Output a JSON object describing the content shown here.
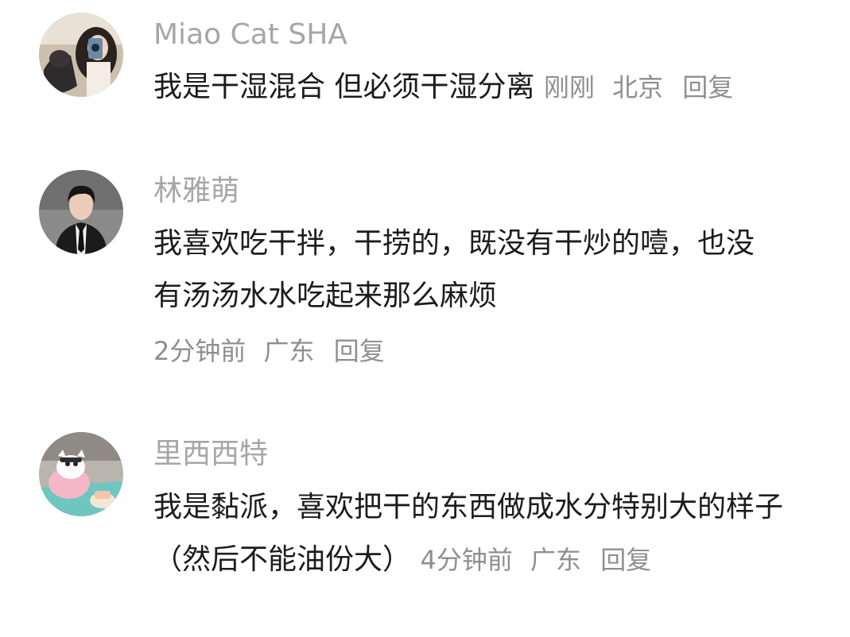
{
  "comments": [
    {
      "username": "Miao Cat SHA",
      "text": "我是干湿混合 但必须干湿分离",
      "time": "刚刚",
      "location": "北京",
      "reply": "回复"
    },
    {
      "username": "林雅萌",
      "text": "我喜欢吃干拌，干捞的，既没有干炒的噎，也没有汤汤水水吃起来那么麻烦",
      "time": "2分钟前",
      "location": "广东",
      "reply": "回复"
    },
    {
      "username": "里西西特",
      "text": "我是黏派，喜欢把干的东西做成水分特别大的样子（然后不能油份大）",
      "time": "4分钟前",
      "location": "广东",
      "reply": "回复"
    }
  ],
  "colors": {
    "username": "#a6a6a6",
    "text": "#1c1c1c",
    "meta": "#8f8f8f",
    "background": "#ffffff"
  }
}
